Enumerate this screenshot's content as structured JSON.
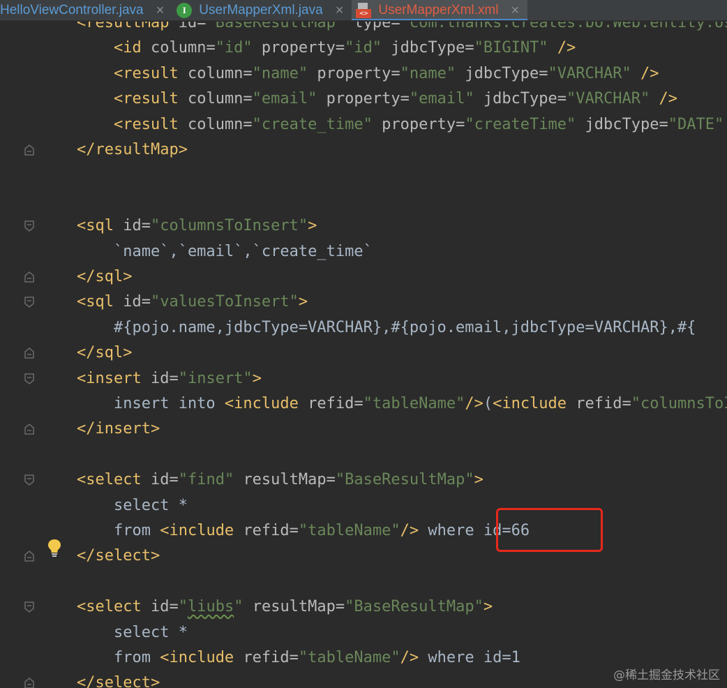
{
  "tabs": [
    {
      "label": "HelloViewController.java",
      "close": "×",
      "icon": "none"
    },
    {
      "label": "UserMapperXml.java",
      "close": "×",
      "icon": "interface-icon",
      "icon_letter": "I"
    },
    {
      "label": "UserMapperXml.xml",
      "close": "×",
      "icon": "xml-file-icon",
      "icon_text": "<>",
      "active": true
    }
  ],
  "editor": {
    "lines": [
      {
        "t": [
          [
            "tag",
            "<resultMap "
          ],
          [
            "attr",
            "id="
          ],
          [
            "val",
            "\"BaseResultMap\" "
          ],
          [
            "attr",
            "type="
          ],
          [
            "val",
            "\"com.thanks.creates.bo.Web.entity.User\""
          ]
        ]
      },
      {
        "t": [
          [
            "txt",
            "    "
          ],
          [
            "tag",
            "<id "
          ],
          [
            "attr",
            "column="
          ],
          [
            "val",
            "\"id\" "
          ],
          [
            "attr",
            "property="
          ],
          [
            "val",
            "\"id\" "
          ],
          [
            "attr",
            "jdbcType="
          ],
          [
            "val",
            "\"BIGINT\" "
          ],
          [
            "tag",
            "/>"
          ]
        ]
      },
      {
        "t": [
          [
            "txt",
            "    "
          ],
          [
            "tag",
            "<result "
          ],
          [
            "attr",
            "column="
          ],
          [
            "val",
            "\"name\" "
          ],
          [
            "attr",
            "property="
          ],
          [
            "val",
            "\"name\" "
          ],
          [
            "attr",
            "jdbcType="
          ],
          [
            "val",
            "\"VARCHAR\" "
          ],
          [
            "tag",
            "/>"
          ]
        ]
      },
      {
        "t": [
          [
            "txt",
            "    "
          ],
          [
            "tag",
            "<result "
          ],
          [
            "attr",
            "column="
          ],
          [
            "val",
            "\"email\" "
          ],
          [
            "attr",
            "property="
          ],
          [
            "val",
            "\"email\" "
          ],
          [
            "attr",
            "jdbcType="
          ],
          [
            "val",
            "\"VARCHAR\" "
          ],
          [
            "tag",
            "/>"
          ]
        ]
      },
      {
        "t": [
          [
            "txt",
            "    "
          ],
          [
            "tag",
            "<result "
          ],
          [
            "attr",
            "column="
          ],
          [
            "val",
            "\"create_time\" "
          ],
          [
            "attr",
            "property="
          ],
          [
            "val",
            "\"createTime\" "
          ],
          [
            "attr",
            "jdbcType="
          ],
          [
            "val",
            "\"DATE\" "
          ],
          [
            "tag",
            "/>"
          ]
        ]
      },
      {
        "t": [
          [
            "tag",
            "</resultMap>"
          ]
        ]
      },
      {
        "t": []
      },
      {
        "t": []
      },
      {
        "t": [
          [
            "tag",
            "<sql "
          ],
          [
            "attr",
            "id="
          ],
          [
            "val",
            "\"columnsToInsert\""
          ],
          [
            "tag",
            ">"
          ]
        ]
      },
      {
        "t": [
          [
            "txt",
            "    `name`,`email`,`create_time`"
          ]
        ]
      },
      {
        "t": [
          [
            "tag",
            "</sql>"
          ]
        ]
      },
      {
        "t": [
          [
            "tag",
            "<sql "
          ],
          [
            "attr",
            "id="
          ],
          [
            "val",
            "\"valuesToInsert\""
          ],
          [
            "tag",
            ">"
          ]
        ]
      },
      {
        "t": [
          [
            "txt",
            "    #{pojo.name,jdbcType=VARCHAR},#{pojo.email,jdbcType=VARCHAR},#{"
          ]
        ]
      },
      {
        "t": [
          [
            "tag",
            "</sql>"
          ]
        ]
      },
      {
        "t": [
          [
            "tag",
            "<insert "
          ],
          [
            "attr",
            "id="
          ],
          [
            "val",
            "\"insert\""
          ],
          [
            "tag",
            ">"
          ]
        ]
      },
      {
        "t": [
          [
            "txt",
            "    insert into "
          ],
          [
            "tag",
            "<include "
          ],
          [
            "attr",
            "refid="
          ],
          [
            "val",
            "\"tableName\""
          ],
          [
            "tag",
            "/>"
          ],
          [
            "txt",
            "("
          ],
          [
            "tag",
            "<include "
          ],
          [
            "attr",
            "refid="
          ],
          [
            "val",
            "\"columnsToInsert\""
          ]
        ]
      },
      {
        "t": [
          [
            "tag",
            "</insert>"
          ]
        ]
      },
      {
        "t": []
      },
      {
        "t": [
          [
            "tag",
            "<select "
          ],
          [
            "attr",
            "id="
          ],
          [
            "val",
            "\"find\" "
          ],
          [
            "attr",
            "resultMap="
          ],
          [
            "val",
            "\"BaseResultMap\""
          ],
          [
            "tag",
            ">"
          ]
        ]
      },
      {
        "t": [
          [
            "txt",
            "    select *"
          ]
        ]
      },
      {
        "t": [
          [
            "txt",
            "    from "
          ],
          [
            "tag",
            "<include "
          ],
          [
            "attr",
            "refid="
          ],
          [
            "val",
            "\"tableName\""
          ],
          [
            "tag",
            "/>"
          ],
          [
            "txt",
            " where id=66"
          ]
        ]
      },
      {
        "t": [
          [
            "tag",
            "</select>"
          ]
        ]
      },
      {
        "t": []
      },
      {
        "t": [
          [
            "tag",
            "<select "
          ],
          [
            "attr",
            "id="
          ],
          [
            "val",
            "\""
          ],
          [
            "valtypo",
            "liubs"
          ],
          [
            "val",
            "\" "
          ],
          [
            "attr",
            "resultMap="
          ],
          [
            "val",
            "\"BaseResultMap\""
          ],
          [
            "tag",
            ">"
          ]
        ]
      },
      {
        "t": [
          [
            "txt",
            "    select *"
          ]
        ]
      },
      {
        "t": [
          [
            "txt",
            "    from "
          ],
          [
            "tag",
            "<include "
          ],
          [
            "attr",
            "refid="
          ],
          [
            "val",
            "\"tableName\""
          ],
          [
            "tag",
            "/>"
          ],
          [
            "txt",
            " where id=1"
          ]
        ]
      },
      {
        "t": [
          [
            "tag",
            "</select>"
          ]
        ]
      }
    ],
    "fold_markers": [
      {
        "line": 5,
        "kind": "end"
      },
      {
        "line": 8,
        "kind": "start"
      },
      {
        "line": 10,
        "kind": "end"
      },
      {
        "line": 11,
        "kind": "start"
      },
      {
        "line": 13,
        "kind": "end"
      },
      {
        "line": 14,
        "kind": "start"
      },
      {
        "line": 16,
        "kind": "end"
      },
      {
        "line": 18,
        "kind": "start"
      },
      {
        "line": 21,
        "kind": "end"
      },
      {
        "line": 23,
        "kind": "start"
      },
      {
        "line": 26,
        "kind": "end"
      }
    ],
    "intention_icon": "lightbulb-icon"
  },
  "watermark": "@稀土掘金技术社区",
  "colors": {
    "background": "#2b2b2b",
    "tag": "#e8bf6a",
    "attribute": "#bababa",
    "value": "#6a8759",
    "text": "#a9b7c6",
    "highlight": "#e8291c"
  }
}
